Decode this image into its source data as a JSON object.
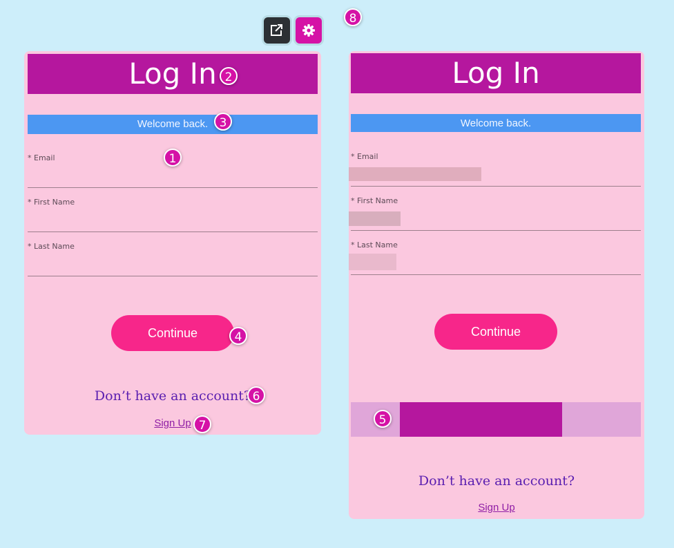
{
  "toolbar": {
    "open_external_icon": "open-external-icon",
    "settings_icon": "gear-icon",
    "dark_color": "#2c3034",
    "accent_color": "#d512a6"
  },
  "login_form": {
    "title": "Log In",
    "welcome": "Welcome back.",
    "fields": [
      {
        "label": "* Email",
        "value": ""
      },
      {
        "label": "* First Name",
        "value": ""
      },
      {
        "label": "* Last Name",
        "value": ""
      }
    ],
    "continue_label": "Continue",
    "question": "Don’t have an account?",
    "signup_label": "Sign Up"
  },
  "preview_form": {
    "title": "Log In",
    "welcome": "Welcome back.",
    "fields": [
      {
        "label": "* Email"
      },
      {
        "label": "* First Name"
      },
      {
        "label": "* Last Name"
      }
    ],
    "continue_label": "Continue",
    "question": "Don’t have an account?",
    "signup_label": "Sign Up"
  },
  "colors": {
    "header": "#b5179e",
    "welcome_bar": "#4c97f2",
    "button": "#f7268a",
    "card": "#fbc8df",
    "background": "#cdeefa",
    "question_text": "#5a1eb0",
    "link": "#8f1ea5"
  },
  "badges": [
    "1",
    "2",
    "3",
    "4",
    "5",
    "6",
    "7",
    "8"
  ]
}
